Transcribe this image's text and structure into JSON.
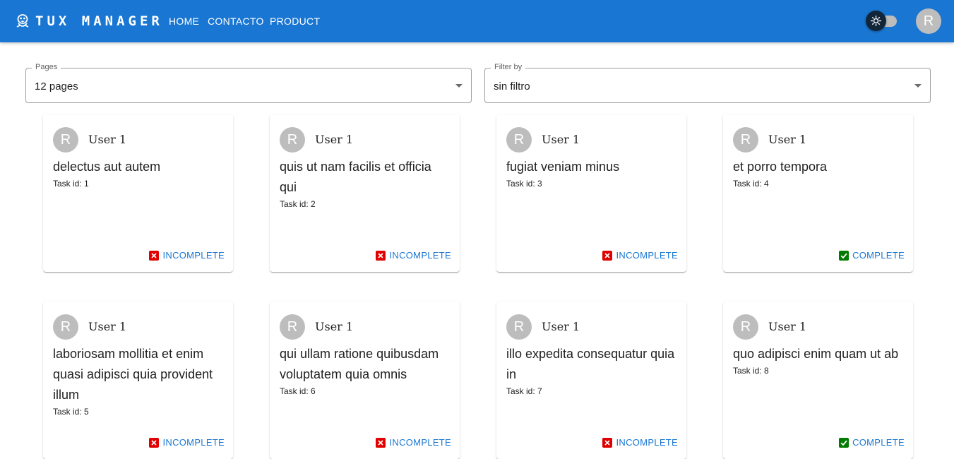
{
  "app": {
    "brand": "TUX MANAGER",
    "nav": [
      "HOME",
      "CONTACTO",
      "PRODUCT"
    ],
    "user_avatar_letter": "R",
    "theme_toggle_icon": "sun-icon"
  },
  "filters": {
    "pages": {
      "label": "Pages",
      "value": "12 pages"
    },
    "filter_by": {
      "label": "Filter by",
      "value": "sin filtro"
    }
  },
  "colors": {
    "appbar": "#1976d2",
    "incomplete": "#e00000",
    "complete": "#007a00",
    "link": "#1976d2"
  },
  "tasks": [
    {
      "avatar": "R",
      "user": "User 1",
      "title": "delectus aut autem",
      "task_id": "Task id: 1",
      "status": "INCOMPLETE"
    },
    {
      "avatar": "R",
      "user": "User 1",
      "title": "quis ut nam facilis et officia qui",
      "task_id": "Task id: 2",
      "status": "INCOMPLETE"
    },
    {
      "avatar": "R",
      "user": "User 1",
      "title": "fugiat veniam minus",
      "task_id": "Task id: 3",
      "status": "INCOMPLETE"
    },
    {
      "avatar": "R",
      "user": "User 1",
      "title": "et porro tempora",
      "task_id": "Task id: 4",
      "status": "COMPLETE"
    },
    {
      "avatar": "R",
      "user": "User 1",
      "title": "laboriosam mollitia et enim quasi adipisci quia provident illum",
      "task_id": "Task id: 5",
      "status": "INCOMPLETE"
    },
    {
      "avatar": "R",
      "user": "User 1",
      "title": "qui ullam ratione quibusdam voluptatem quia omnis",
      "task_id": "Task id: 6",
      "status": "INCOMPLETE"
    },
    {
      "avatar": "R",
      "user": "User 1",
      "title": "illo expedita consequatur quia in",
      "task_id": "Task id: 7",
      "status": "INCOMPLETE"
    },
    {
      "avatar": "R",
      "user": "User 1",
      "title": "quo adipisci enim quam ut ab",
      "task_id": "Task id: 8",
      "status": "COMPLETE"
    }
  ]
}
